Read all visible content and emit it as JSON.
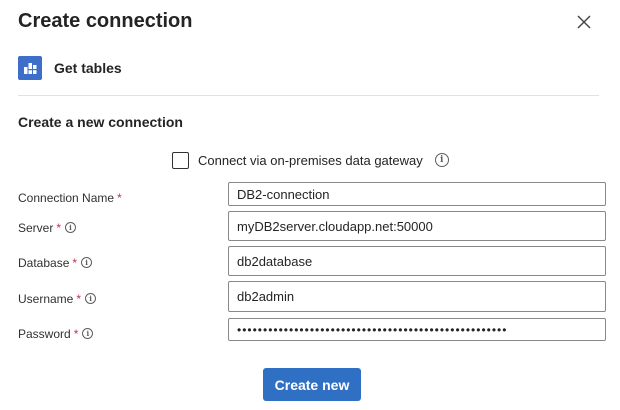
{
  "dialog": {
    "title": "Create connection",
    "close_icon": "close-icon",
    "action": {
      "label": "Get tables",
      "icon": "db2-table-icon",
      "icon_color": "#3d6ec9"
    }
  },
  "section_title": "Create a new connection",
  "gateway": {
    "label": "Connect via on-premises data gateway",
    "checked": false,
    "info_icon": "info-icon"
  },
  "required_marker": "*",
  "fields": {
    "connection_name": {
      "label": "Connection Name",
      "value": "DB2-connection",
      "required": true,
      "has_info": false
    },
    "server": {
      "label": "Server",
      "value": "myDB2server.cloudapp.net:50000",
      "required": true,
      "has_info": true
    },
    "database": {
      "label": "Database",
      "value": "db2database",
      "required": true,
      "has_info": true
    },
    "username": {
      "label": "Username",
      "value": "db2admin",
      "required": true,
      "has_info": true
    },
    "password": {
      "label": "Password",
      "value": "••••••••••••••••••••••••••••••••••••••••••••••••••••",
      "required": true,
      "has_info": true
    }
  },
  "create_button": {
    "label": "Create new",
    "color": "#2f6fc4"
  },
  "colors": {
    "required": "#c4314b",
    "divider": "#e1e1e1",
    "input_border": "#8a8886"
  }
}
